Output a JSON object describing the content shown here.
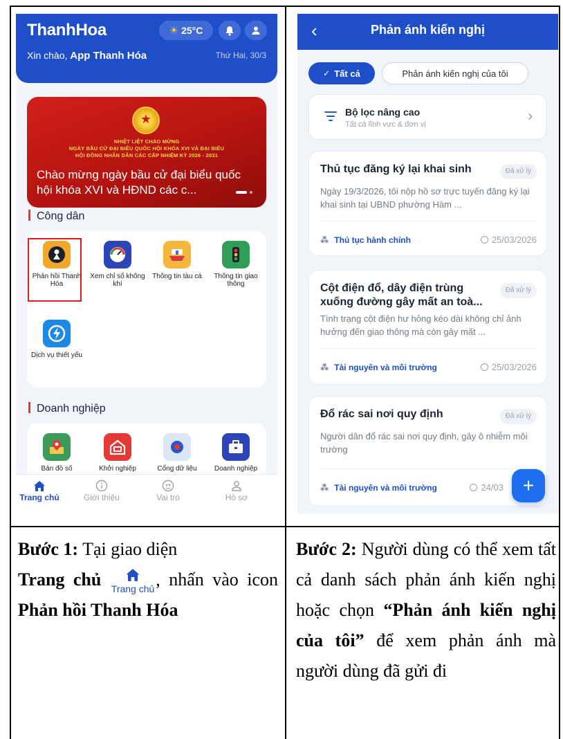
{
  "colors": {
    "primary": "#1f4fc8",
    "accent_red": "#e01a1a",
    "fab": "#1f6ef0",
    "banner_red": "#c41612",
    "muted": "#9aa1ad"
  },
  "screen1": {
    "brand": "ThanhHoa",
    "weather": "25°C",
    "icons": {
      "weather": "sun-icon",
      "bell": "bell-icon",
      "user": "user-icon"
    },
    "greeting_prefix": "Xin chào,",
    "greeting_name": "App Thanh Hóa",
    "date": "Thứ Hai, 30/3",
    "banner": {
      "header_lines": [
        "NHIỆT LIỆT CHÀO MỪNG",
        "NGÀY BẦU CỬ ĐẠI BIỂU QUỐC HỘI KHÓA XVI VÀ ĐẠI BIỂU",
        "HỘI ĐỒNG NHÂN DÂN CÁC CẤP NHIỆM KỲ 2026 - 2031"
      ],
      "caption": "Chào mừng ngày bầu cử đại biểu quốc hội khóa XVI và HĐND các c..."
    },
    "sections": {
      "citizen": "Công dân",
      "business": "Doanh nghiệp"
    },
    "citizen_tiles": [
      {
        "label": "Phản hồi Thanh Hóa",
        "icon": "feedback-icon"
      },
      {
        "label": "Xem chỉ số không khí",
        "icon": "air-gauge-icon"
      },
      {
        "label": "Thông tin tàu cá",
        "icon": "fishing-boat-icon"
      },
      {
        "label": "Thông tin giao thông",
        "icon": "traffic-light-icon"
      },
      {
        "label": "Dịch vụ thiết yếu",
        "icon": "lightning-icon"
      }
    ],
    "business_tiles": [
      {
        "label": "Bản đồ số",
        "icon": "map-pin-icon"
      },
      {
        "label": "Khởi nghiệp",
        "icon": "startup-icon"
      },
      {
        "label": "Cổng dữ liệu",
        "icon": "data-portal-icon"
      },
      {
        "label": "Doanh nghiệp",
        "icon": "briefcase-icon"
      }
    ],
    "nav": [
      {
        "label": "Trang chủ",
        "icon": "home-icon"
      },
      {
        "label": "Giới thiệu",
        "icon": "info-icon"
      },
      {
        "label": "Vai trò",
        "icon": "role-icon"
      },
      {
        "label": "Hồ sơ",
        "icon": "profile-icon"
      }
    ]
  },
  "screen2": {
    "title": "Phản ánh kiến nghị",
    "chip_all": "Tất cả",
    "chip_mine": "Phản ánh kiến nghị của tôi",
    "filter": {
      "title": "Bộ lọc nâng cao",
      "subtitle": "Tất cả lĩnh vực & đơn vị"
    },
    "cards": [
      {
        "title": "Thủ tục đăng ký lại khai sinh",
        "status": "Đã xử lý",
        "desc": "Ngày 19/3/2026, tôi nộp hồ sơ trực tuyến đăng ký lại khai sinh tại UBND phường Hàm ...",
        "category": "Thủ tục hành chính",
        "date": "25/03/2026"
      },
      {
        "title": "Cột điện đổ, dây điện trùng xuống đường gây mất an toà...",
        "status": "Đã xử lý",
        "desc": "Tình trạng cột điện hư hỏng kéo dài không chỉ ảnh hưởng đến giao thông mà còn gây mất ...",
        "category": "Tài nguyên và môi trường",
        "date": "25/03/2026"
      },
      {
        "title": "Đổ rác sai nơi quy định",
        "status": "Đã xử lý",
        "desc": "Người dân đổ rác sai nơi quy định, gây ô nhiễm môi trường",
        "category": "Tài nguyên và môi trường",
        "date": "24/03"
      }
    ],
    "fab": "+"
  },
  "captions": {
    "step1_label": "Bước 1:",
    "step1_text_a": "Tại giao diện",
    "step1_home_bold": "Trang chủ",
    "step1_inline_label": "Trang chủ",
    "step1_text_b": ", nhấn vào icon",
    "step1_target": "Phản hồi Thanh Hóa",
    "step2_label": "Bước 2:",
    "step2_text_a": "Người dùng có thể xem tất cả danh sách phản ánh kiến nghị hoặc chọn",
    "step2_quote": "“Phản ánh kiến nghị của tôi”",
    "step2_text_b": "để xem phản ánh mà người dùng đã gửi đi"
  }
}
